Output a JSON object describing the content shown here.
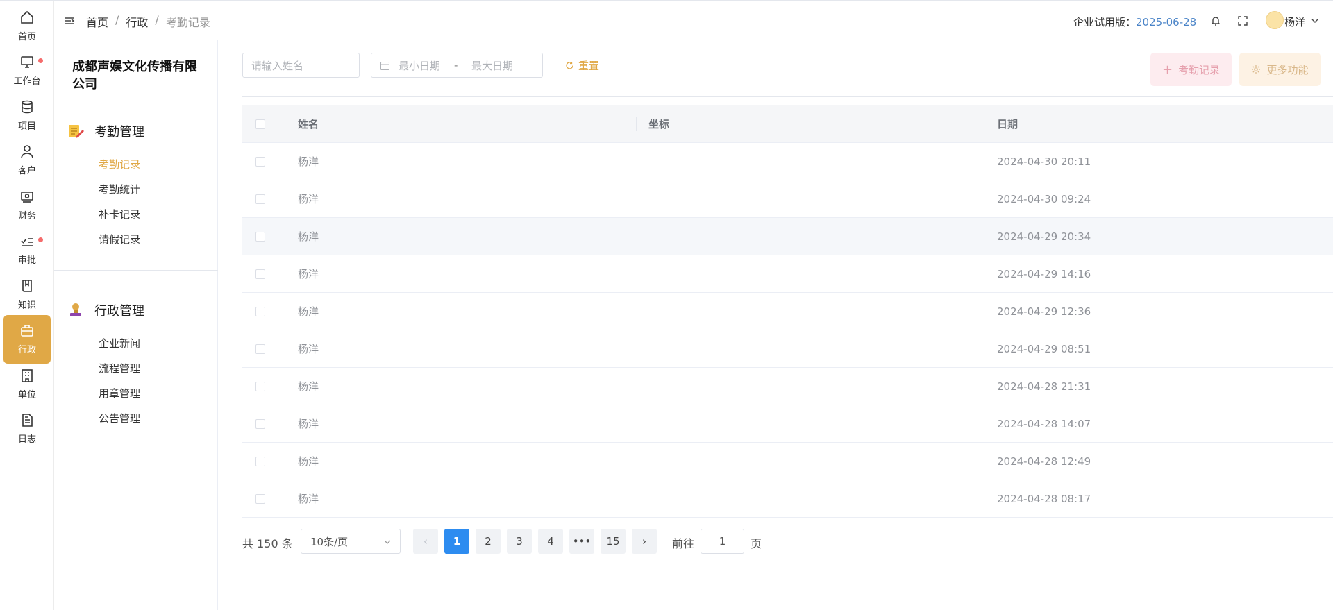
{
  "rail": [
    {
      "label": "首页",
      "icon": "home-icon",
      "active": false,
      "badge": false
    },
    {
      "label": "工作台",
      "icon": "monitor-icon",
      "active": false,
      "badge": true
    },
    {
      "label": "项目",
      "icon": "database-icon",
      "active": false,
      "badge": false
    },
    {
      "label": "客户",
      "icon": "user-icon",
      "active": false,
      "badge": false
    },
    {
      "label": "财务",
      "icon": "money-icon",
      "active": false,
      "badge": false
    },
    {
      "label": "审批",
      "icon": "checklist-icon",
      "active": false,
      "badge": true
    },
    {
      "label": "知识",
      "icon": "book-icon",
      "active": false,
      "badge": false
    },
    {
      "label": "行政",
      "icon": "briefcase-icon",
      "active": true,
      "badge": false
    },
    {
      "label": "单位",
      "icon": "building-icon",
      "active": false,
      "badge": false
    },
    {
      "label": "日志",
      "icon": "document-icon",
      "active": false,
      "badge": false
    }
  ],
  "header": {
    "breadcrumb": [
      "首页",
      "行政",
      "考勤记录"
    ],
    "trial_label": "企业试用版：",
    "trial_date": "2025-06-28",
    "user_name": "杨洋"
  },
  "submenu": {
    "company": "成都声娱文化传播有限公司",
    "groups": [
      {
        "title": "考勤管理",
        "items": [
          "考勤记录",
          "考勤统计",
          "补卡记录",
          "请假记录"
        ],
        "active": "考勤记录"
      },
      {
        "title": "行政管理",
        "items": [
          "企业新闻",
          "流程管理",
          "用章管理",
          "公告管理"
        ]
      }
    ]
  },
  "filters": {
    "name_placeholder": "请输入姓名",
    "date_start_placeholder": "最小日期",
    "date_sep": "-",
    "date_end_placeholder": "最大日期",
    "reset_label": "重置"
  },
  "actions": {
    "add_label": "考勤记录",
    "more_label": "更多功能"
  },
  "table": {
    "columns": [
      "姓名",
      "坐标",
      "日期"
    ],
    "rows": [
      {
        "name": "杨洋",
        "coord": "",
        "date": "2024-04-30 20:11"
      },
      {
        "name": "杨洋",
        "coord": "",
        "date": "2024-04-30 09:24"
      },
      {
        "name": "杨洋",
        "coord": "",
        "date": "2024-04-29 20:34"
      },
      {
        "name": "杨洋",
        "coord": "",
        "date": "2024-04-29 14:16"
      },
      {
        "name": "杨洋",
        "coord": "",
        "date": "2024-04-29 12:36"
      },
      {
        "name": "杨洋",
        "coord": "",
        "date": "2024-04-29 08:51"
      },
      {
        "name": "杨洋",
        "coord": "",
        "date": "2024-04-28 21:31"
      },
      {
        "name": "杨洋",
        "coord": "",
        "date": "2024-04-28 14:07"
      },
      {
        "name": "杨洋",
        "coord": "",
        "date": "2024-04-28 12:49"
      },
      {
        "name": "杨洋",
        "coord": "",
        "date": "2024-04-28 08:17"
      }
    ]
  },
  "pagination": {
    "total_label": "共 150 条",
    "page_size": "10条/页",
    "pages": [
      "1",
      "2",
      "3",
      "4",
      "•••",
      "15"
    ],
    "current": "1",
    "goto_label": "前往",
    "goto_value": "1",
    "page_unit": "页"
  },
  "colors": {
    "accent": "#e0a846",
    "primary": "#2d8cf0",
    "link": "#4a84c8",
    "badge": "#f56c6c"
  }
}
